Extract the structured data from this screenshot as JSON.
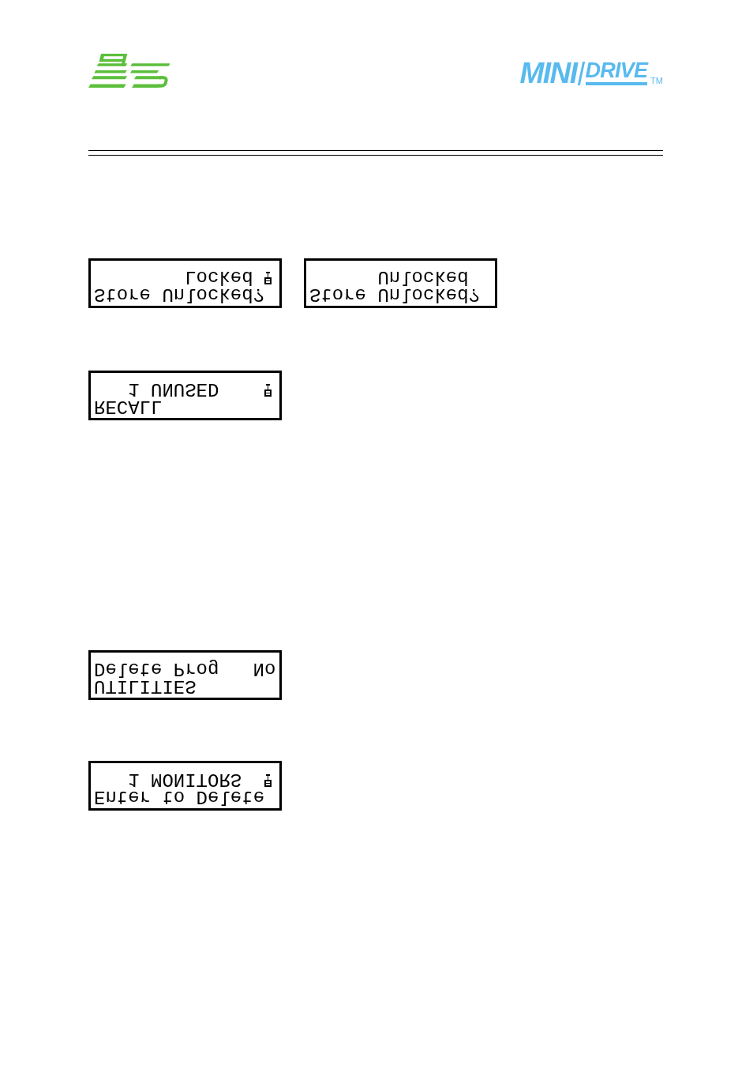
{
  "header": {
    "product_logo": {
      "word_1": "MINI",
      "word_2": "DRIVE",
      "trademark": "TM"
    }
  },
  "display_rows": [
    {
      "displays": [
        {
          "lines": [
            {
              "text": "Locked",
              "symbol": true
            },
            {
              "text": "Store Unlocked?",
              "symbol": false
            }
          ]
        },
        {
          "lines": [
            {
              "text": "Unlocked",
              "symbol": false
            },
            {
              "text": "Store Unlocked?",
              "symbol": false
            }
          ]
        }
      ]
    },
    {
      "displays": [
        {
          "lines": [
            {
              "text": "1 UNUSED",
              "symbol": true
            },
            {
              "text": "RECALL",
              "symbol": false
            }
          ]
        }
      ]
    },
    {
      "displays": [
        {
          "lines": [
            {
              "text": "Delete Prog",
              "value": "No",
              "symbol": false
            },
            {
              "text": "UTILITIES",
              "symbol": false
            }
          ]
        }
      ]
    },
    {
      "displays": [
        {
          "lines": [
            {
              "text": "1 MONITORS",
              "symbol": true
            },
            {
              "text": "Enter to Delete",
              "symbol": false
            }
          ]
        }
      ]
    }
  ]
}
